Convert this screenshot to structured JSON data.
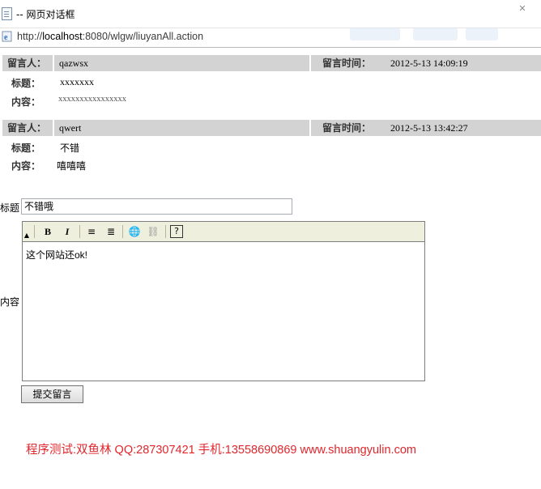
{
  "window": {
    "title": "-- 网页对话框",
    "close": "✕"
  },
  "address": {
    "scheme": "http://",
    "host": "localhost",
    "path": ":8080/wlgw/liuyanAll.action"
  },
  "messages": [
    {
      "author_label": "留言人：",
      "author": "qazwsx",
      "time_label": "留言时间：",
      "time": "2012-5-13 14:09:19",
      "subject_label": "标题：",
      "subject": "xxxxxxx",
      "content_label": "内容：",
      "content": "xxxxxxxxxxxxxxxx"
    },
    {
      "author_label": "留言人：",
      "author": "qwert",
      "time_label": "留言时间：",
      "time": "2012-5-13 13:42:27",
      "subject_label": "标题：",
      "subject": "不错",
      "content_label": "内容：",
      "content": "嘻嘻嘻"
    }
  ],
  "form": {
    "title_label": "标题",
    "title_value": "不错哦",
    "content_label": "内容",
    "content_value": "这个网站还ok!",
    "submit_label": "提交留言",
    "toolbar": {
      "bold": "B",
      "italic": "I",
      "ordered_list": "≡",
      "unordered_list": "≣",
      "link": "🌐",
      "unlink": "⛓",
      "help": "?"
    }
  },
  "footer": {
    "text": "程序测试:双鱼林 QQ:287307421 手机:13558690869 www.shuangyulin.com"
  }
}
